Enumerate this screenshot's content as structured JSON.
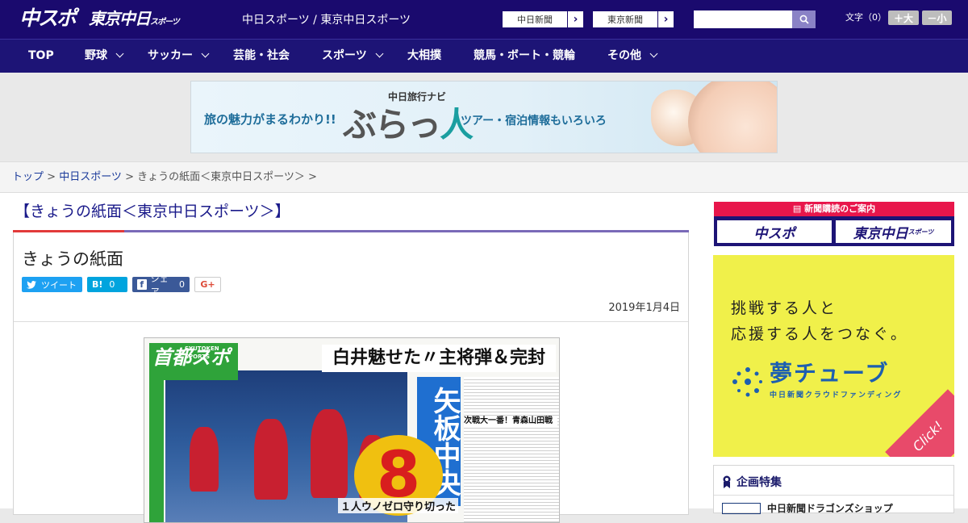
{
  "header": {
    "logo_chuspo": "中スポ",
    "logo_tokyo": "東京中日",
    "logo_tokyo_suffix": "スポーツ",
    "site_name": "中日スポーツ / 東京中日スポーツ",
    "paper_links": [
      "中日新聞",
      "東京新聞"
    ],
    "search_placeholder": "",
    "font_size_label": "文字（0）",
    "font_bigger": "＋大",
    "font_smaller": "－小"
  },
  "nav": {
    "items": [
      {
        "label": "TOP",
        "has_menu": false
      },
      {
        "label": "野球",
        "has_menu": true
      },
      {
        "label": "サッカー",
        "has_menu": true
      },
      {
        "label": "芸能・社会",
        "has_menu": false
      },
      {
        "label": "スポーツ",
        "has_menu": true
      },
      {
        "label": "大相撲",
        "has_menu": false
      },
      {
        "label": "競馬・ボート・競輪",
        "has_menu": false
      },
      {
        "label": "その他",
        "has_menu": true
      }
    ]
  },
  "banner": {
    "left_text": "旅の魅力がまるわかり!!",
    "sub_text": "中日旅行ナビ",
    "logo_part1": "ぶらっ",
    "logo_part2": "人",
    "right_text": "ツアー・宿泊情報もいろいろ"
  },
  "breadcrumb": {
    "home": "トップ",
    "section": "中日スポーツ",
    "current": "きょうの紙面＜東京中日スポーツ＞"
  },
  "page": {
    "heading": "【きょうの紙面＜東京中日スポーツ＞】",
    "article_title": "きょうの紙面",
    "date": "2019年1月4日",
    "share": {
      "tweet": "ツイート",
      "hatena_label": "B!",
      "hatena_count": "0",
      "facebook_label": "シェア",
      "facebook_count": "0",
      "gplus": "G+"
    }
  },
  "newspaper": {
    "logo": "首都スポ",
    "logo_sub": "SYUTOKEN SPORTS",
    "headline": "白井魅せた〃主将弾＆完封",
    "vertical_title": "矢板中央",
    "big_number": "8",
    "subhead": "次戦大一番！青森山田戦",
    "caption": "１人ウノゼロ守り切った"
  },
  "sidebar": {
    "subscribe_label": "新聞購読のご案内",
    "subscribe_chuspo": "中スポ",
    "subscribe_tokyo": "東京中日",
    "subscribe_tokyo_suffix": "スポーツ",
    "yume_line1": "挑戦する人と",
    "yume_line2": "応援する人をつなぐ。",
    "yume_logo": "夢チューブ",
    "yume_sub": "中日新聞クラウドファンディング",
    "yume_click": "Click!",
    "kikaku_title": "企画特集",
    "kikaku_item": "中日新聞ドラゴンズショップ"
  },
  "colors": {
    "topbar": "#1a0a6e",
    "nav": "#1d1476",
    "accent_red": "#e23a3a",
    "accent_purple": "#7a6ab8",
    "twitter": "#1da1f2",
    "hatena": "#00a4de",
    "facebook": "#3b5998",
    "yume_bg": "#f0f04a"
  }
}
